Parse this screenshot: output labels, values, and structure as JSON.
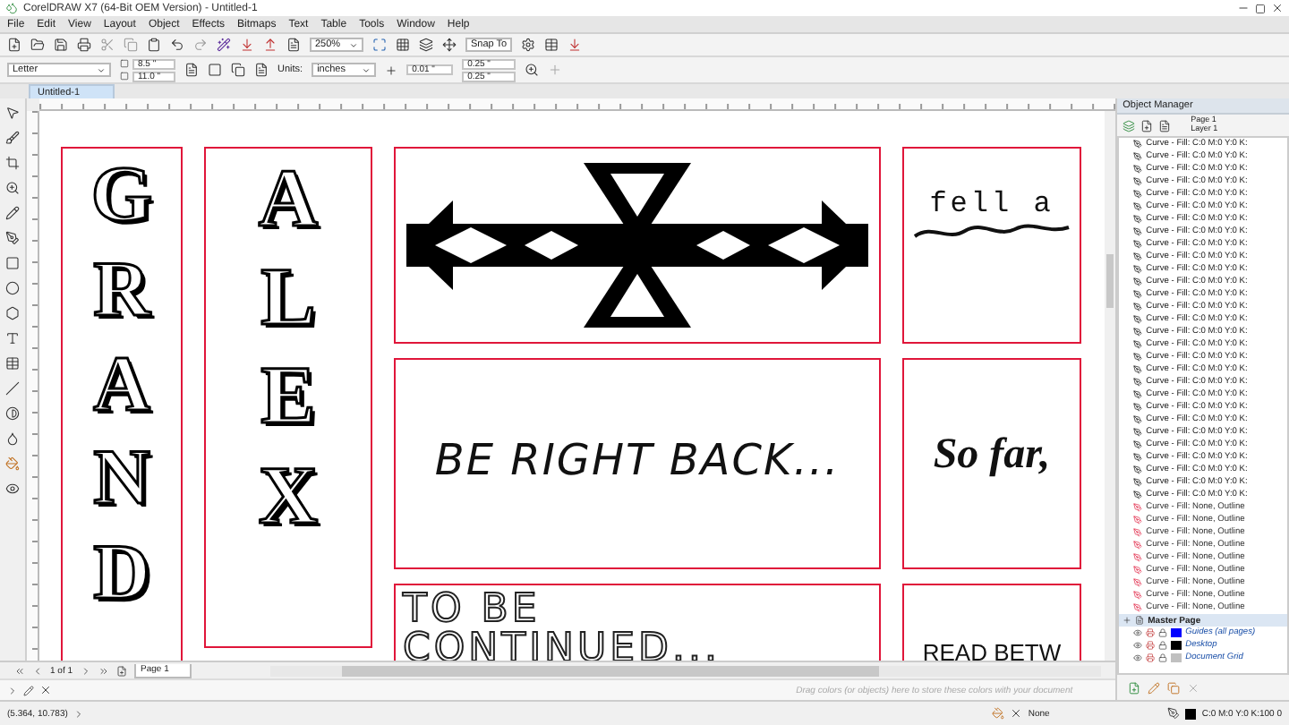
{
  "window": {
    "title": "CorelDRAW X7 (64-Bit OEM Version) - Untitled-1"
  },
  "menu": [
    "File",
    "Edit",
    "View",
    "Layout",
    "Object",
    "Effects",
    "Bitmaps",
    "Text",
    "Table",
    "Tools",
    "Window",
    "Help"
  ],
  "toolbar": {
    "zoom": "250%",
    "snap": "Snap To"
  },
  "property_bar": {
    "page_size": "Letter",
    "width": "8.5 \"",
    "height": "11.0 \"",
    "units_label": "Units:",
    "units": "inches",
    "nudge": "0.01 \"",
    "dup_x": "0.25 \"",
    "dup_y": "0.25 \""
  },
  "document_tabs": [
    {
      "label": "Untitled-1",
      "selected": true
    }
  ],
  "canvas": {
    "cards": [
      {
        "kind": "letters",
        "letters": [
          "G",
          "R",
          "A",
          "N",
          "D"
        ]
      },
      {
        "kind": "letters",
        "letters": [
          "A",
          "L",
          "E",
          "X"
        ]
      },
      {
        "kind": "pattern"
      },
      {
        "kind": "scribble",
        "text": "fell a"
      },
      {
        "kind": "brush",
        "text": "BE RIGHT BACK..."
      },
      {
        "kind": "script",
        "text": "So far,"
      },
      {
        "kind": "outline",
        "text": "TO BE CONTINUED..."
      },
      {
        "kind": "sans",
        "text": "READ BETW"
      }
    ]
  },
  "page_nav": {
    "count": "1 of 1",
    "tabs": [
      {
        "label": "Page 1",
        "selected": true
      }
    ]
  },
  "palette_hint": "Drag colors (or objects) here to store these colors with your document",
  "object_manager": {
    "title": "Object Manager",
    "page": "Page 1",
    "layer": "Layer 1",
    "objects": [
      {
        "kind": "filled",
        "label": "Curve - Fill: C:0 M:0 Y:0 K:"
      },
      {
        "kind": "filled",
        "label": "Curve - Fill: C:0 M:0 Y:0 K:"
      },
      {
        "kind": "filled",
        "label": "Curve - Fill: C:0 M:0 Y:0 K:"
      },
      {
        "kind": "filled",
        "label": "Curve - Fill: C:0 M:0 Y:0 K:"
      },
      {
        "kind": "filled",
        "label": "Curve - Fill: C:0 M:0 Y:0 K:"
      },
      {
        "kind": "filled",
        "label": "Curve - Fill: C:0 M:0 Y:0 K:"
      },
      {
        "kind": "filled",
        "label": "Curve - Fill: C:0 M:0 Y:0 K:"
      },
      {
        "kind": "filled",
        "label": "Curve - Fill: C:0 M:0 Y:0 K:"
      },
      {
        "kind": "filled",
        "label": "Curve - Fill: C:0 M:0 Y:0 K:"
      },
      {
        "kind": "filled",
        "label": "Curve - Fill: C:0 M:0 Y:0 K:"
      },
      {
        "kind": "filled",
        "label": "Curve - Fill: C:0 M:0 Y:0 K:"
      },
      {
        "kind": "filled",
        "label": "Curve - Fill: C:0 M:0 Y:0 K:"
      },
      {
        "kind": "filled",
        "label": "Curve - Fill: C:0 M:0 Y:0 K:"
      },
      {
        "kind": "filled",
        "label": "Curve - Fill: C:0 M:0 Y:0 K:"
      },
      {
        "kind": "filled",
        "label": "Curve - Fill: C:0 M:0 Y:0 K:"
      },
      {
        "kind": "filled",
        "label": "Curve - Fill: C:0 M:0 Y:0 K:"
      },
      {
        "kind": "filled",
        "label": "Curve - Fill: C:0 M:0 Y:0 K:"
      },
      {
        "kind": "filled",
        "label": "Curve - Fill: C:0 M:0 Y:0 K:"
      },
      {
        "kind": "filled",
        "label": "Curve - Fill: C:0 M:0 Y:0 K:"
      },
      {
        "kind": "filled",
        "label": "Curve - Fill: C:0 M:0 Y:0 K:"
      },
      {
        "kind": "filled",
        "label": "Curve - Fill: C:0 M:0 Y:0 K:"
      },
      {
        "kind": "filled",
        "label": "Curve - Fill: C:0 M:0 Y:0 K:"
      },
      {
        "kind": "filled",
        "label": "Curve - Fill: C:0 M:0 Y:0 K:"
      },
      {
        "kind": "filled",
        "label": "Curve - Fill: C:0 M:0 Y:0 K:"
      },
      {
        "kind": "filled",
        "label": "Curve - Fill: C:0 M:0 Y:0 K:"
      },
      {
        "kind": "filled",
        "label": "Curve - Fill: C:0 M:0 Y:0 K:"
      },
      {
        "kind": "filled",
        "label": "Curve - Fill: C:0 M:0 Y:0 K:"
      },
      {
        "kind": "filled",
        "label": "Curve - Fill: C:0 M:0 Y:0 K:"
      },
      {
        "kind": "filled",
        "label": "Curve - Fill: C:0 M:0 Y:0 K:"
      },
      {
        "kind": "outline",
        "label": "Curve - Fill: None, Outline"
      },
      {
        "kind": "outline",
        "label": "Curve - Fill: None, Outline"
      },
      {
        "kind": "outline",
        "label": "Curve - Fill: None, Outline"
      },
      {
        "kind": "outline",
        "label": "Curve - Fill: None, Outline"
      },
      {
        "kind": "outline",
        "label": "Curve - Fill: None, Outline"
      },
      {
        "kind": "outline",
        "label": "Curve - Fill: None, Outline"
      },
      {
        "kind": "outline",
        "label": "Curve - Fill: None, Outline"
      },
      {
        "kind": "outline",
        "label": "Curve - Fill: None, Outline"
      },
      {
        "kind": "outline",
        "label": "Curve - Fill: None, Outline"
      }
    ],
    "master_page": {
      "label": "Master Page",
      "layers": [
        {
          "label": "Guides (all pages)",
          "color": "#0000ff"
        },
        {
          "label": "Desktop",
          "color": "#000000"
        },
        {
          "label": "Document Grid",
          "color": "#c0c0c0"
        }
      ]
    }
  },
  "status": {
    "coordinates": "(5.364, 10.783)",
    "fill": "None",
    "outline": "C:0 M:0 Y:0 K:100 0"
  }
}
